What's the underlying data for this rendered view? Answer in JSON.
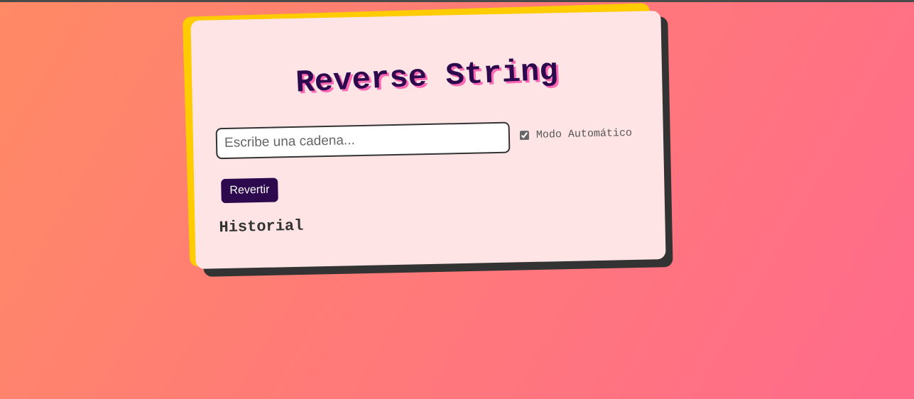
{
  "app": {
    "title": "Reverse String"
  },
  "input": {
    "value": "",
    "placeholder": "Escribe una cadena..."
  },
  "auto_mode": {
    "label": "Modo Automático",
    "checked": true
  },
  "actions": {
    "revert_label": "Revertir"
  },
  "history": {
    "title": "Historial",
    "items": []
  },
  "colors": {
    "accent": "#2d0a4e",
    "title_shadow": "#ff69b4",
    "frame_yellow": "#ffcc00",
    "card_background": "#ffe4e6"
  }
}
